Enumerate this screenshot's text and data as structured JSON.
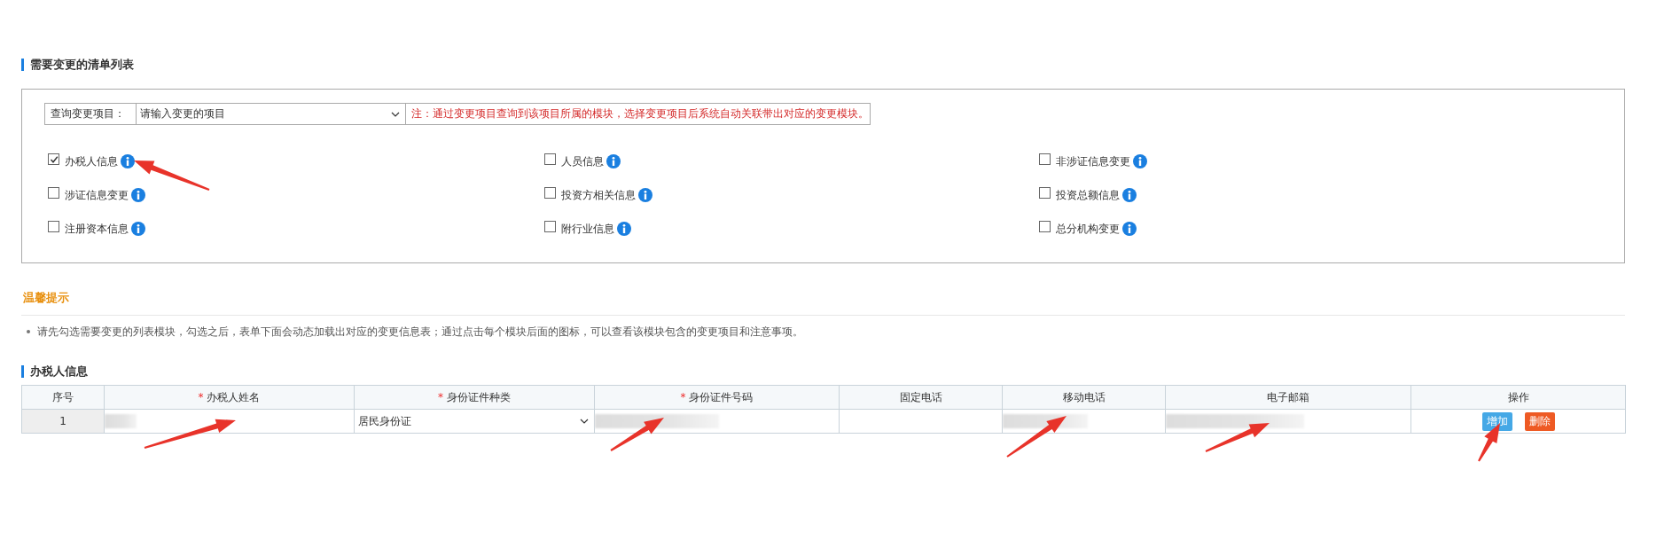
{
  "change_list": {
    "title": "需要变更的清单列表",
    "query": {
      "label": "查询变更项目：",
      "placeholder": "请输入变更的项目",
      "note": "注：通过变更项目查询到该项目所属的模块，选择变更项目后系统自动关联带出对应的变更模块。"
    },
    "modules": [
      {
        "label": "办税人信息",
        "checked": true
      },
      {
        "label": "人员信息",
        "checked": false
      },
      {
        "label": "非涉证信息变更",
        "checked": false
      },
      {
        "label": "涉证信息变更",
        "checked": false
      },
      {
        "label": "投资方相关信息",
        "checked": false
      },
      {
        "label": "投资总额信息",
        "checked": false
      },
      {
        "label": "注册资本信息",
        "checked": false
      },
      {
        "label": "附行业信息",
        "checked": false
      },
      {
        "label": "总分机构变更",
        "checked": false
      }
    ]
  },
  "tips": {
    "title": "温馨提示",
    "items": [
      "请先勾选需要变更的列表模块，勾选之后，表单下面会动态加载出对应的变更信息表；通过点击每个模块后面的图标，可以查看该模块包含的变更项目和注意事项。"
    ]
  },
  "taxpayer_table": {
    "title": "办税人信息",
    "columns": [
      {
        "label": "序号",
        "required": false
      },
      {
        "label": "办税人姓名",
        "required": true,
        "required_mark": "*"
      },
      {
        "label": "身份证件种类",
        "required": true,
        "required_mark": "*"
      },
      {
        "label": "身份证件号码",
        "required": true,
        "required_mark": "*"
      },
      {
        "label": "固定电话",
        "required": false
      },
      {
        "label": "移动电话",
        "required": false
      },
      {
        "label": "电子邮箱",
        "required": false
      },
      {
        "label": "操作",
        "required": false
      }
    ],
    "rows": [
      {
        "cells": [
          {
            "kind": "index",
            "text": "1"
          },
          {
            "kind": "blurred"
          },
          {
            "kind": "select",
            "value": "居民身份证"
          },
          {
            "kind": "blurred"
          },
          {
            "kind": "input"
          },
          {
            "kind": "blurred"
          },
          {
            "kind": "blurred"
          },
          {
            "kind": "actions",
            "buttons": [
              {
                "label": "增加",
                "kind": "add"
              },
              {
                "label": "删除",
                "kind": "delete"
              }
            ]
          }
        ]
      }
    ]
  }
}
